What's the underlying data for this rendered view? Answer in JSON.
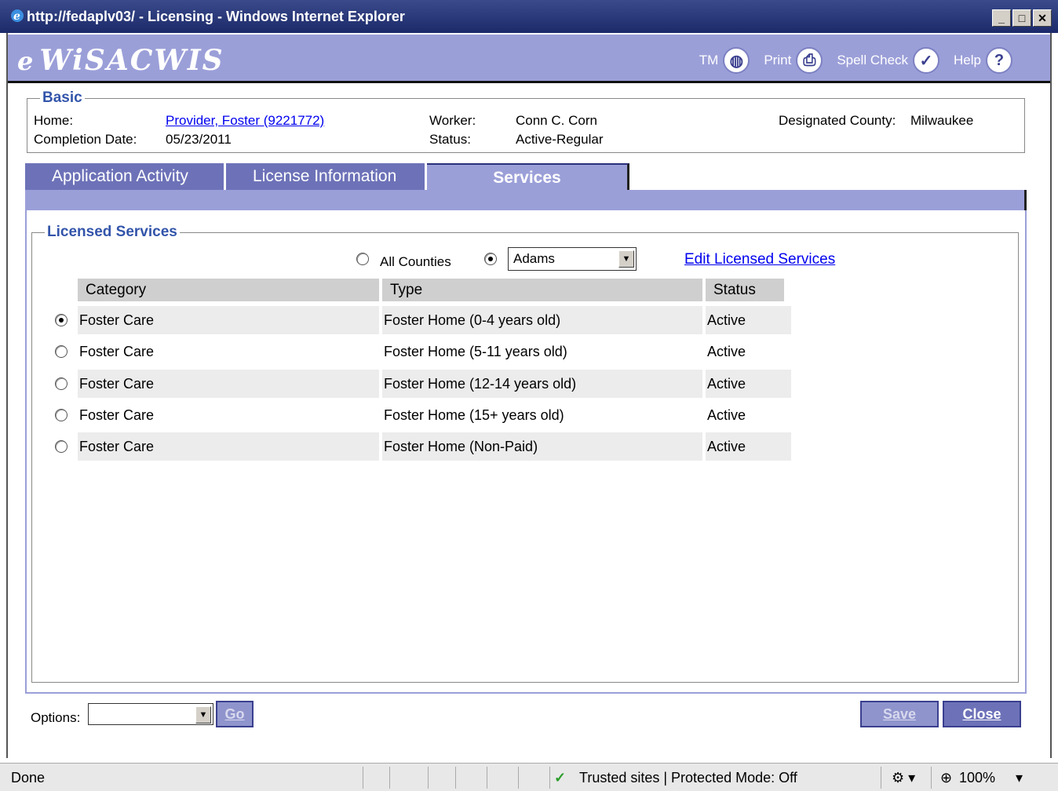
{
  "window": {
    "title": "http://fedaplv03/ - Licensing - Windows Internet Explorer",
    "min": "_",
    "max": "□",
    "close": "✕"
  },
  "app": {
    "logo_e": "e",
    "logo_name": "WiSACWIS",
    "tools": {
      "tm": "TM",
      "print": "Print",
      "spell": "Spell Check",
      "help": "Help"
    }
  },
  "basic": {
    "legend": "Basic",
    "home_label": "Home:",
    "home_value": "Provider, Foster (9221772)",
    "completion_label": "Completion Date:",
    "completion_value": "05/23/2011",
    "worker_label": "Worker:",
    "worker_value": "Conn C. Corn",
    "status_label": "Status:",
    "status_value": "Active-Regular",
    "county_label": "Designated County:",
    "county_value": "Milwaukee"
  },
  "tabs": [
    {
      "label": "Application Activity"
    },
    {
      "label": "License Information"
    },
    {
      "label": "Services"
    }
  ],
  "services": {
    "legend": "Licensed Services",
    "all_counties": "All Counties",
    "county_selected": "Adams",
    "edit_link": "Edit Licensed Services",
    "headers": {
      "category": "Category",
      "type": "Type",
      "status": "Status"
    },
    "rows": [
      {
        "category": "Foster Care",
        "type": "Foster Home (0-4 years old)",
        "status": "Active",
        "selected": true
      },
      {
        "category": "Foster Care",
        "type": "Foster Home (5-11 years old)",
        "status": "Active",
        "selected": false
      },
      {
        "category": "Foster Care",
        "type": "Foster Home (12-14 years old)",
        "status": "Active",
        "selected": false
      },
      {
        "category": "Foster Care",
        "type": "Foster Home (15+ years old)",
        "status": "Active",
        "selected": false
      },
      {
        "category": "Foster Care",
        "type": "Foster Home (Non-Paid)",
        "status": "Active",
        "selected": false
      }
    ]
  },
  "footer": {
    "options_label": "Options:",
    "options_value": "",
    "go": "Go",
    "save": "Save",
    "close": "Close"
  },
  "statusbar": {
    "done": "Done",
    "zone": "Trusted sites | Protected Mode: Off",
    "zoom": "100%"
  }
}
